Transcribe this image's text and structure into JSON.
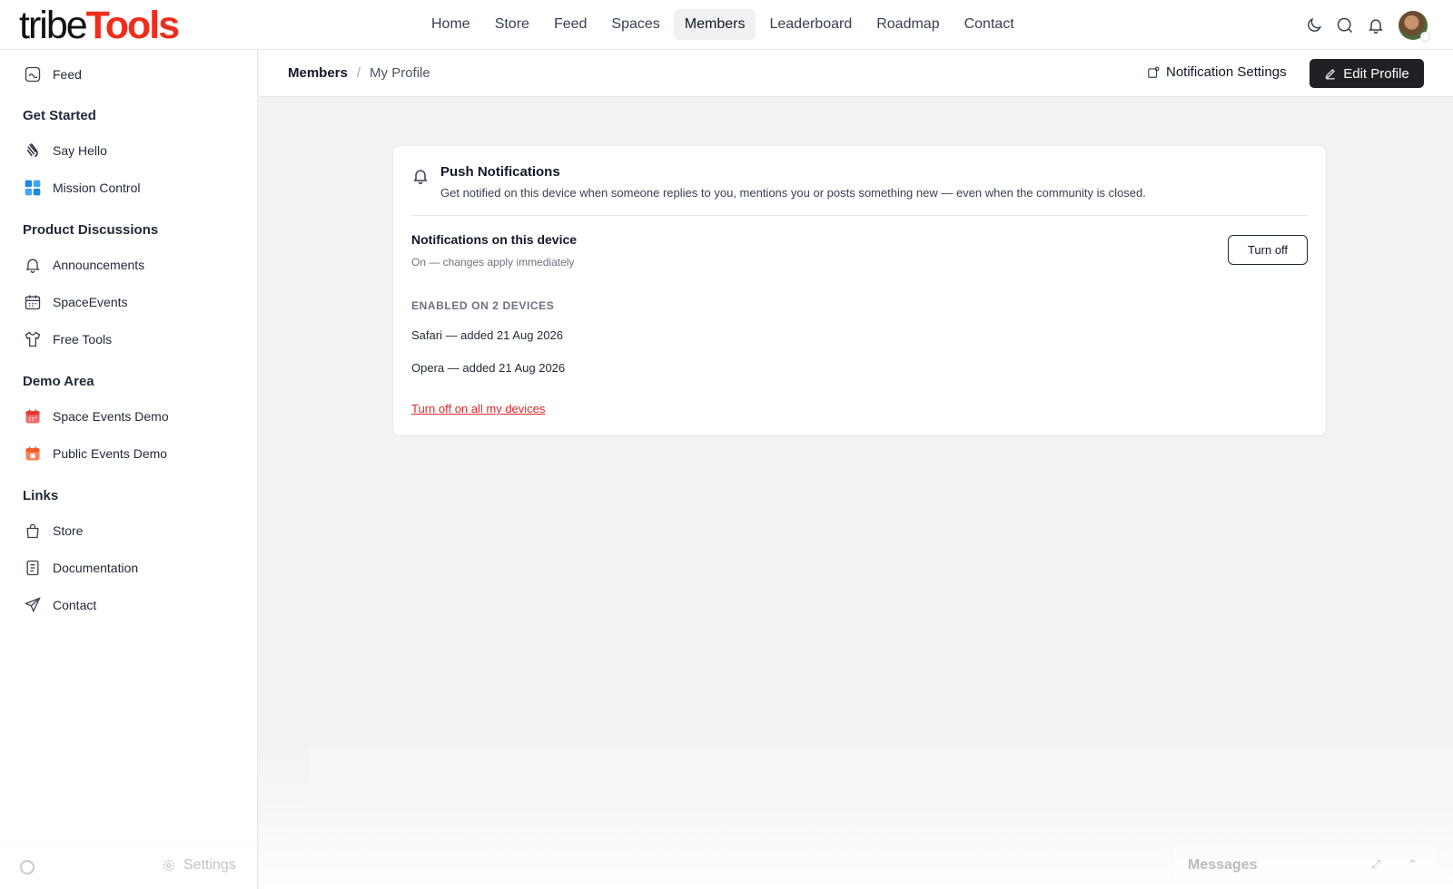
{
  "brand": {
    "part1": "tribe",
    "part2": "Tools"
  },
  "nav": [
    {
      "label": "Home"
    },
    {
      "label": "Store"
    },
    {
      "label": "Feed"
    },
    {
      "label": "Spaces"
    },
    {
      "label": "Members",
      "active": true
    },
    {
      "label": "Leaderboard"
    },
    {
      "label": "Roadmap"
    },
    {
      "label": "Contact"
    }
  ],
  "sidebar": {
    "feed": "Feed",
    "sections": [
      {
        "title": "Get Started",
        "items": [
          {
            "label": "Say Hello",
            "icon": "wave-hand-icon"
          },
          {
            "label": "Mission Control",
            "icon": "grid-icon"
          }
        ]
      },
      {
        "title": "Product Discussions",
        "items": [
          {
            "label": "Announcements",
            "icon": "bell-icon"
          },
          {
            "label": "SpaceEvents",
            "icon": "calendar-icon"
          },
          {
            "label": "Free Tools",
            "icon": "tshirt-icon"
          }
        ]
      },
      {
        "title": "Demo Area",
        "items": [
          {
            "label": "Space Events Demo",
            "icon": "calendar-red-icon"
          },
          {
            "label": "Public Events Demo",
            "icon": "calendar-orange-icon"
          }
        ]
      },
      {
        "title": "Links",
        "items": [
          {
            "label": "Store",
            "icon": "bag-icon"
          },
          {
            "label": "Documentation",
            "icon": "document-icon"
          },
          {
            "label": "Contact",
            "icon": "paper-plane-icon"
          }
        ]
      }
    ],
    "settings": "Settings"
  },
  "breadcrumb": {
    "parent": "Members",
    "current": "My Profile"
  },
  "actions": {
    "notification_settings": "Notification Settings",
    "edit_profile": "Edit Profile"
  },
  "card": {
    "title": "Push Notifications",
    "description": "Get notified on this device when someone replies to you, mentions you or posts something new — even when the community is closed.",
    "device_title": "Notifications on this device",
    "device_status": "On — changes apply immediately",
    "turn_off": "Turn off",
    "enabled_heading": "ENABLED ON 2 DEVICES",
    "devices": [
      "Safari — added 21 Aug 2026",
      "Opera — added 21 Aug 2026"
    ],
    "turn_off_all": "Turn off on all my devices"
  },
  "messages": {
    "title": "Messages"
  },
  "colors": {
    "brand_red": "#ef2d1d",
    "link_red": "#dc2626",
    "dark_button": "#1f2125"
  }
}
